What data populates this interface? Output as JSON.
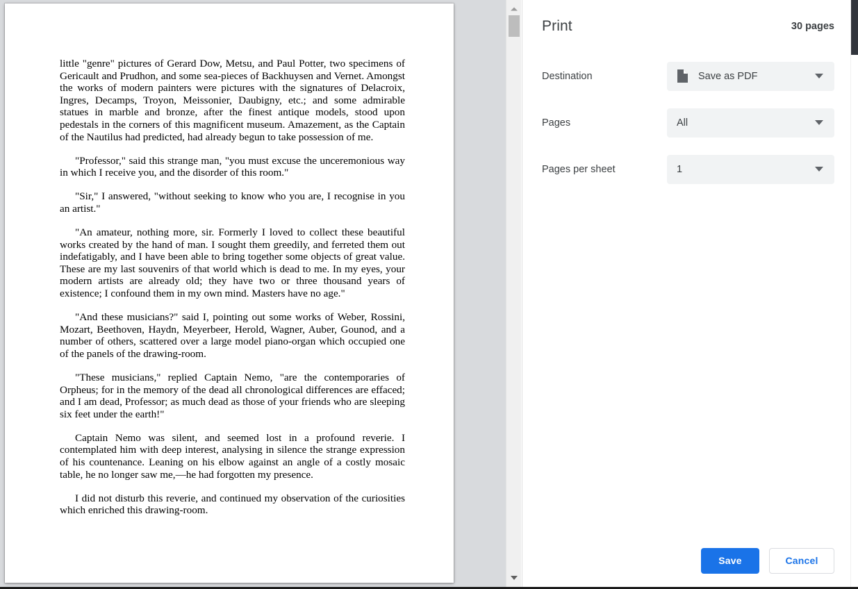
{
  "dialog": {
    "title": "Print",
    "page_count": "30 pages",
    "settings": [
      {
        "label": "Destination",
        "value": "Save as PDF",
        "icon": "pdf-document-icon"
      },
      {
        "label": "Pages",
        "value": "All",
        "icon": null
      },
      {
        "label": "Pages per sheet",
        "value": "1",
        "icon": null
      }
    ],
    "actions": {
      "save_label": "Save",
      "cancel_label": "Cancel"
    },
    "colors": {
      "accent": "#1a73e8",
      "control_background": "#f1f3f4",
      "text": "#3c4043"
    }
  },
  "preview": {
    "paragraphs": [
      "little \"genre\" pictures of Gerard Dow, Metsu, and Paul Potter, two specimens of Gericault and Prudhon, and some sea-pieces of Backhuysen and Vernet. Amongst the works of modern painters were pictures with the signatures of Delacroix, Ingres, Decamps, Troyon, Meissonier, Daubigny, etc.; and some admirable statues in marble and bronze, after the finest antique models, stood upon pedestals in the corners of this magnificent museum. Amazement, as the Captain of the Nautilus had predicted, had already begun to take possession of me.",
      "\"Professor,\" said this strange man, \"you must excuse the unceremonious way in which I receive you, and the disorder of this room.\"",
      "\"Sir,\" I answered, \"without seeking to know who you are, I recognise in you an artist.\"",
      "\"An amateur, nothing more, sir. Formerly I loved to collect these beautiful works created by the hand of man. I sought them greedily, and ferreted them out indefatigably, and I have been able to bring together some objects of great value. These are my last souvenirs of that world which is dead to me. In my eyes, your modern artists are already old; they have two or three thousand years of existence; I confound them in my own mind. Masters have no age.\"",
      "\"And these musicians?\" said I, pointing out some works of Weber, Rossini, Mozart, Beethoven, Haydn, Meyerbeer, Herold, Wagner, Auber, Gounod, and a number of others, scattered over a large model piano-organ which occupied one of the panels of the drawing-room.",
      "\"These musicians,\" replied Captain Nemo, \"are the contemporaries of Orpheus; for in the memory of the dead all chronological differences are effaced; and I am dead, Professor; as much dead as those of your friends who are sleeping six feet under the earth!\"",
      "Captain Nemo was silent, and seemed lost in a profound reverie. I contemplated him with deep interest, analysing in silence the strange expression of his countenance. Leaning on his elbow against an angle of a costly mosaic table, he no longer saw me,—he had forgotten my presence.",
      "I did not disturb this reverie, and continued my observation of the curiosities which enriched this drawing-room."
    ]
  }
}
